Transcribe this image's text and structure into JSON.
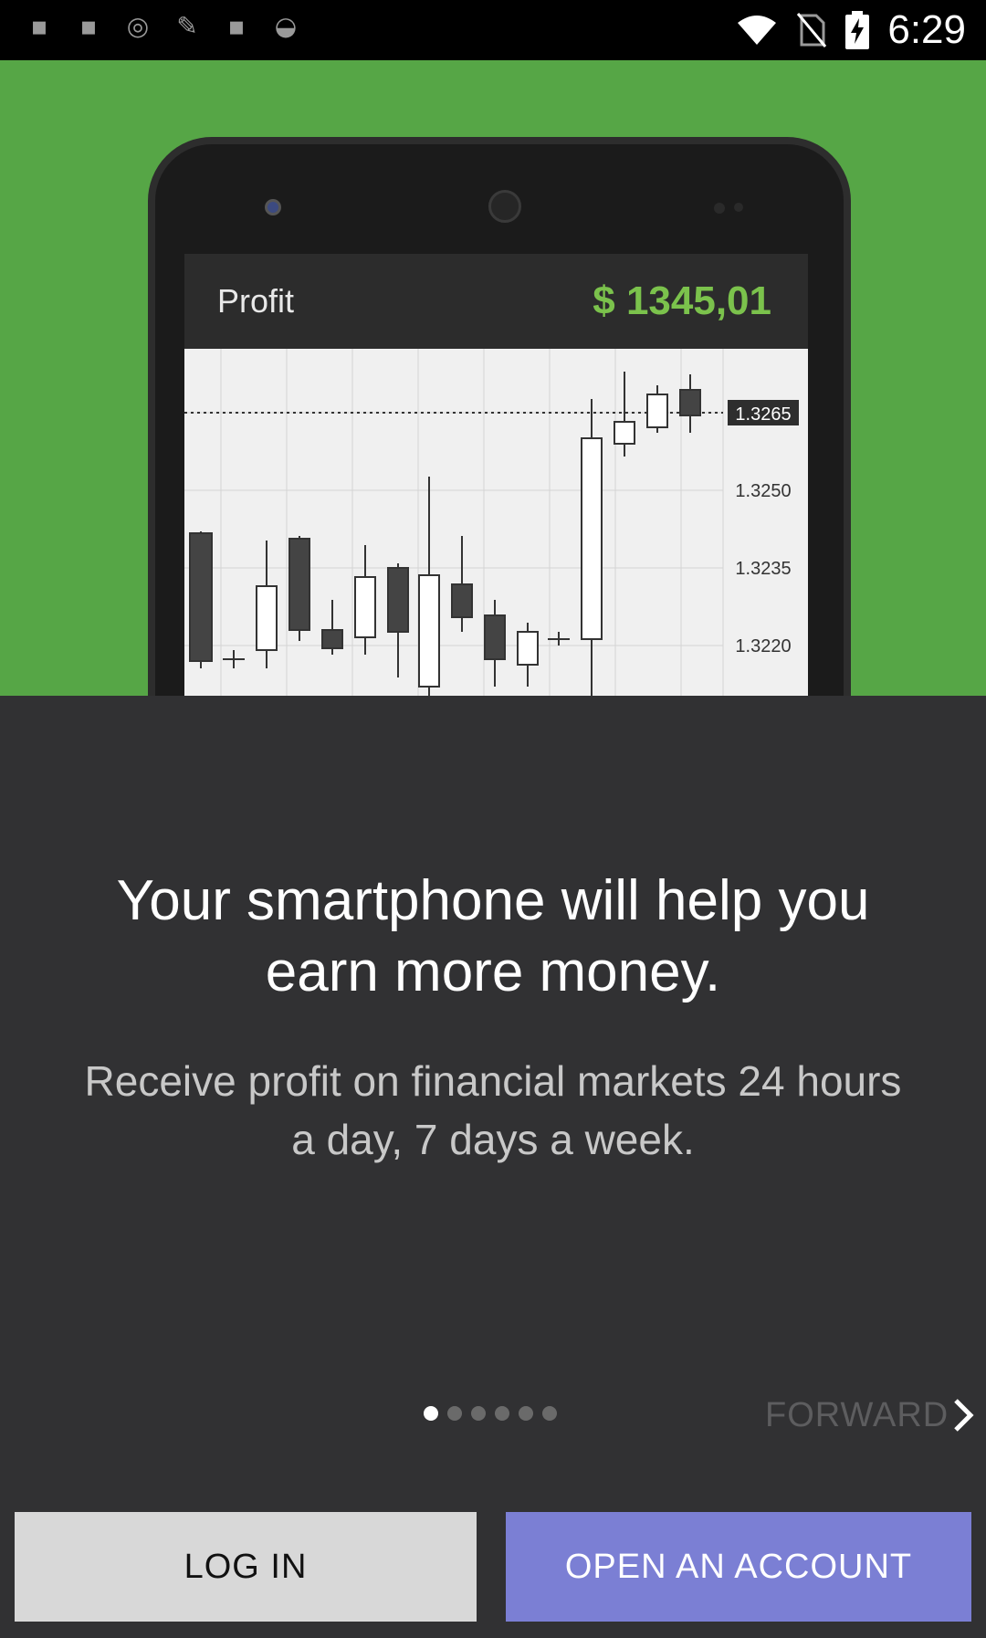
{
  "status_bar": {
    "time": "6:29",
    "left_icons": [
      "notification-icon",
      "notification-icon",
      "notification-icon",
      "notification-icon",
      "notification-icon",
      "notification-icon"
    ],
    "right_icons": [
      "wifi-icon",
      "no-sim-icon",
      "battery-charging-icon"
    ]
  },
  "hero": {
    "background_color": "#56a646",
    "phone_screen": {
      "profit_label": "Profit",
      "profit_value": "$ 1345,01",
      "price_labels": [
        "1.3265",
        "1.3250",
        "1.3235",
        "1.3220"
      ]
    }
  },
  "content": {
    "title": "Your smartphone will help you earn more money.",
    "subtitle": "Receive profit on financial  markets 24 hours a day, 7 days a week."
  },
  "pager": {
    "page_count": 6,
    "current_page": 1,
    "forward_label": "FORWARD"
  },
  "buttons": {
    "login_label": "LOG IN",
    "open_account_label": "OPEN AN ACCOUNT"
  },
  "colors": {
    "background": "#313133",
    "accent_button": "#7b7fd4",
    "profit_green": "#7bc24c"
  }
}
